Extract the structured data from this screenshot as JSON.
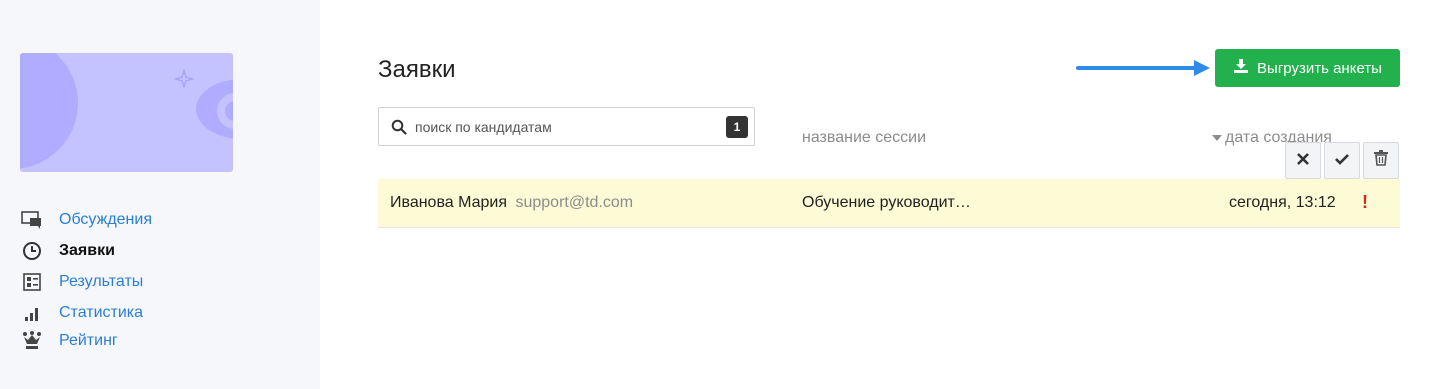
{
  "sidebar": {
    "items": [
      {
        "label": "Обсуждения",
        "icon": "chat-icon",
        "active": false
      },
      {
        "label": "Заявки",
        "icon": "clock-icon",
        "active": true
      },
      {
        "label": "Результаты",
        "icon": "report-icon",
        "active": false
      },
      {
        "label": "Статистика",
        "icon": "bar-chart-icon",
        "active": false
      },
      {
        "label": "Рейтинг",
        "icon": "crown-icon",
        "active": false
      }
    ]
  },
  "main": {
    "title": "Заявки",
    "export_button": {
      "label": "Выгрузить анкеты",
      "icon": "download-icon"
    },
    "search": {
      "placeholder": "поиск по кандидатам",
      "count": "1"
    },
    "columns": {
      "session": "название сессии",
      "date": "дата создания"
    },
    "actions": [
      {
        "name": "reject-button",
        "icon": "close-icon"
      },
      {
        "name": "approve-button",
        "icon": "check-icon"
      },
      {
        "name": "delete-button",
        "icon": "trash-icon"
      }
    ],
    "rows": [
      {
        "name": "Иванова Мария",
        "email": "support@td.com",
        "session": "Обучение руководит…",
        "date": "сегодня, 13:12",
        "flag": "!"
      }
    ]
  },
  "colors": {
    "accent": "#2a7fd4",
    "success": "#22b14c",
    "highlight_row": "#fdfbd5",
    "alert": "#e02020",
    "banner": "#c5c3ff"
  }
}
